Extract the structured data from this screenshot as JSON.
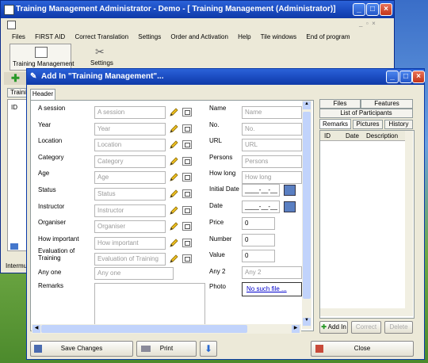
{
  "main_window": {
    "title": "Training Management  Administrator - Demo - [       Training Management (Administrator)]",
    "menu": [
      "Files",
      "FIRST AID",
      "Correct Translation",
      "Settings",
      "Order and Activation",
      "Help",
      "Tile windows",
      "End of program"
    ],
    "toolbar": {
      "training_label": "Training Management",
      "settings_label": "Settings"
    },
    "left_tab": "Traini",
    "left_col": "ID",
    "status": "Intermu"
  },
  "dialog": {
    "title": "Add  In \"Training Management\"...",
    "tab": "Header",
    "left_fields": [
      {
        "label": "A session",
        "placeholder": "A session"
      },
      {
        "label": "Year",
        "placeholder": "Year"
      },
      {
        "label": "Location",
        "placeholder": "Location"
      },
      {
        "label": "Category",
        "placeholder": "Category"
      },
      {
        "label": "Age",
        "placeholder": "Age"
      },
      {
        "label": "Status",
        "placeholder": "Status"
      },
      {
        "label": "Instructor",
        "placeholder": "Instructor"
      },
      {
        "label": "Organiser",
        "placeholder": "Organiser"
      },
      {
        "label": "How important",
        "placeholder": "How important"
      },
      {
        "label": "Evaluation of Training",
        "placeholder": "Evaluation of Training"
      }
    ],
    "any_one": {
      "label": "Any one",
      "placeholder": "Any one"
    },
    "remarks_label": "Remarks",
    "right_fields": [
      {
        "label": "Name",
        "placeholder": "Name"
      },
      {
        "label": "No.",
        "placeholder": "No."
      },
      {
        "label": "URL",
        "placeholder": "URL"
      },
      {
        "label": "Persons",
        "placeholder": "Persons"
      },
      {
        "label": "How long",
        "placeholder": "How long"
      }
    ],
    "initial_date": {
      "label": "Initial Date",
      "value": "____-__-__"
    },
    "date": {
      "label": "Date",
      "value": "____-__-__"
    },
    "price": {
      "label": "Price",
      "value": "0"
    },
    "number": {
      "label": "Number",
      "value": "0"
    },
    "value": {
      "label": "Value",
      "value": "0"
    },
    "any2": {
      "label": "Any 2",
      "placeholder": "Any 2"
    },
    "photo": {
      "label": "Photo",
      "link": "No such file ..."
    },
    "side_tabs": {
      "files": "Files",
      "features": "Features",
      "participants": "List of Participants",
      "remarks": "Remarks",
      "pictures": "Pictures",
      "history": "History"
    },
    "side_columns": [
      "ID",
      "Date",
      "Description"
    ],
    "side_buttons": {
      "add": "Add  In",
      "correct": "Correct",
      "delete": "Delete"
    },
    "bottom_buttons": {
      "save": "Save Changes",
      "print": "Print",
      "close": "Close"
    }
  }
}
